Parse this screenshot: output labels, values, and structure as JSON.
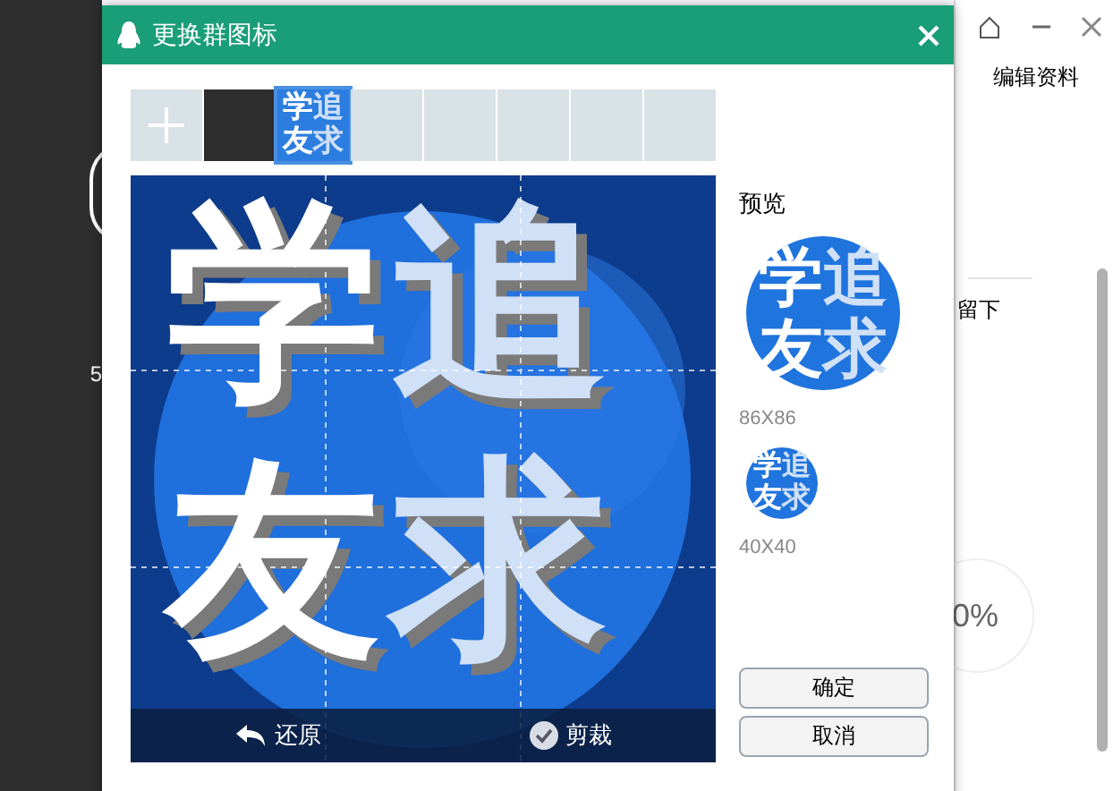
{
  "background_app": {
    "left_text": "5",
    "right_button": "编辑资料",
    "right_text": "留下",
    "progress_text": "0%"
  },
  "dialog": {
    "title": "更换群图标",
    "thumbnails": [
      {
        "kind": "add",
        "selected": false
      },
      {
        "kind": "dark",
        "selected": false
      },
      {
        "kind": "icon",
        "chars": [
          "学",
          "追",
          "友",
          "求"
        ],
        "selected": true
      },
      {
        "kind": "empty",
        "selected": false
      },
      {
        "kind": "empty",
        "selected": false
      },
      {
        "kind": "empty",
        "selected": false
      },
      {
        "kind": "empty",
        "selected": false
      },
      {
        "kind": "empty",
        "selected": false
      }
    ],
    "editor": {
      "chars": [
        "学",
        "追",
        "友",
        "求"
      ],
      "toolbar": [
        {
          "kind": "restore",
          "label": "还原"
        },
        {
          "kind": "crop",
          "label": "剪裁"
        }
      ]
    },
    "preview": {
      "label": "预览",
      "sizes": [
        {
          "kind": "large",
          "chars": [
            "学",
            "追",
            "友",
            "求"
          ],
          "caption": "86X86"
        },
        {
          "kind": "small",
          "chars": [
            "学",
            "追",
            "友",
            "求"
          ],
          "caption": "40X40"
        }
      ]
    },
    "buttons": [
      "确定",
      "取消"
    ]
  }
}
